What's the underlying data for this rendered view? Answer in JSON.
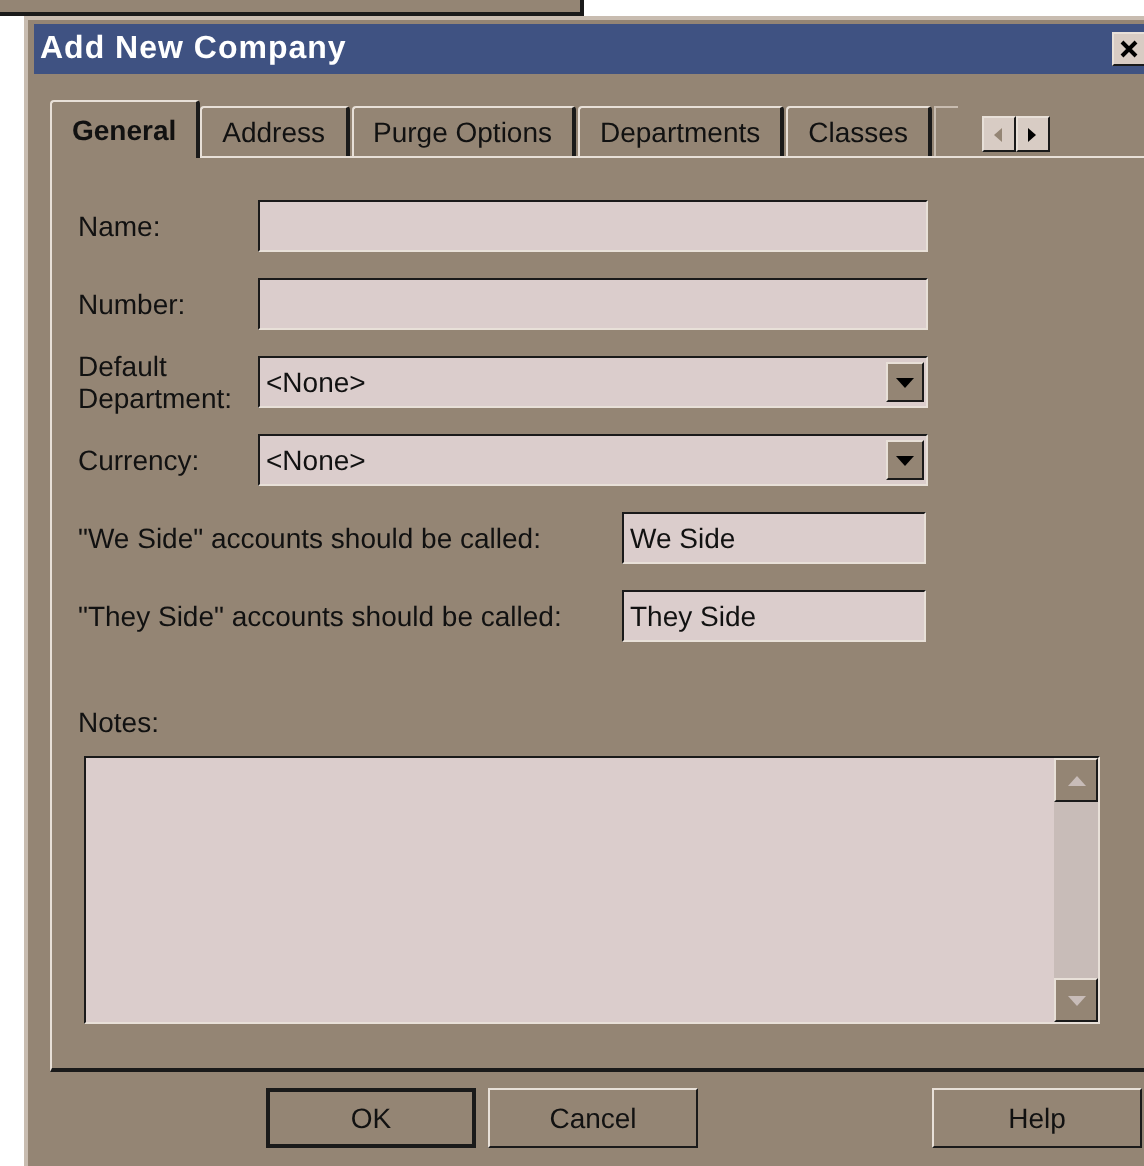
{
  "window": {
    "title": "Add New Company"
  },
  "tabs": [
    {
      "label": "General",
      "selected": true
    },
    {
      "label": "Address",
      "selected": false
    },
    {
      "label": "Purge Options",
      "selected": false
    },
    {
      "label": "Departments",
      "selected": false
    },
    {
      "label": "Classes",
      "selected": false
    }
  ],
  "tab_scroll": {
    "left_disabled": true,
    "right_disabled": false
  },
  "fields": [
    {
      "kind": "text",
      "label": "Name:"
    },
    {
      "kind": "text",
      "label": "Number:"
    },
    {
      "kind": "dropdown",
      "label": "Default Department:",
      "value": "<None>"
    },
    {
      "kind": "dropdown",
      "label": "Currency:",
      "value": "<None>"
    }
  ],
  "side_fields": [
    {
      "label": "\"We Side\" accounts should be called:",
      "value": "We Side"
    },
    {
      "label": "\"They Side\" accounts should be called:",
      "value": "They Side"
    }
  ],
  "notes": {
    "label": "Notes:"
  },
  "buttons": [
    {
      "label": "OK",
      "default": true
    },
    {
      "label": "Cancel",
      "default": false
    },
    {
      "label": "Help",
      "default": false
    }
  ]
}
